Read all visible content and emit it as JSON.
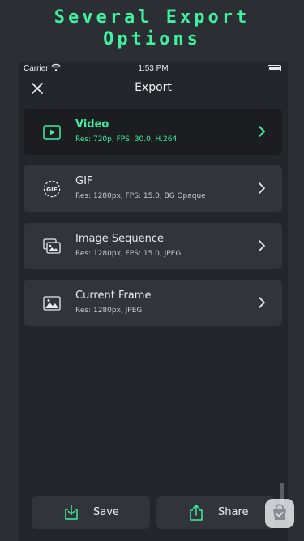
{
  "promo": {
    "line1": "Several Export",
    "line2": "Options"
  },
  "status_bar": {
    "carrier": "Carrier",
    "time": "1:53 PM"
  },
  "nav": {
    "title": "Export"
  },
  "options": [
    {
      "name": "Video",
      "details": "Res: 720p, FPS: 30.0, H.264",
      "selected": true,
      "icon": "video-icon"
    },
    {
      "name": "GIF",
      "details": "Res: 1280px, FPS: 15.0, BG Opaque",
      "selected": false,
      "icon": "gif-icon"
    },
    {
      "name": "Image Sequence",
      "details": "Res: 1280px, FPS: 15.0, JPEG",
      "selected": false,
      "icon": "image-sequence-icon"
    },
    {
      "name": "Current Frame",
      "details": "Res: 1280px, JPEG",
      "selected": false,
      "icon": "image-icon"
    }
  ],
  "actions": {
    "save_label": "Save",
    "share_label": "Share"
  },
  "colors": {
    "accent": "#3ff0a0",
    "background": "#23262a",
    "card": "#31343a",
    "selected_card": "#1b1d20"
  }
}
